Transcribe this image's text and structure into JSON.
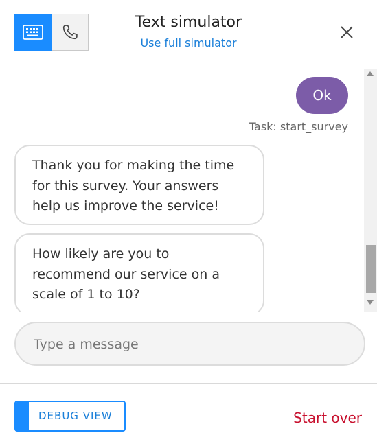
{
  "header": {
    "title": "Text simulator",
    "subtitle_link": "Use full simulator",
    "modes": [
      {
        "name": "keyboard",
        "icon": "keyboard-icon",
        "active": true
      },
      {
        "name": "phone",
        "icon": "phone-icon",
        "active": false
      }
    ],
    "close_icon": "close-icon"
  },
  "chat": {
    "messages": [
      {
        "from": "user",
        "text": "Ok"
      },
      {
        "from": "bot",
        "text": "Thank you for making the time for this survey. Your answers help us improve the service!"
      },
      {
        "from": "bot",
        "text": "How likely are you to recommend our service on a scale of 1 to 10?"
      }
    ],
    "task_label": "Task: start_survey"
  },
  "composer": {
    "placeholder": "Type a message",
    "value": ""
  },
  "footer": {
    "debug_label": "DEBUG VIEW",
    "start_over": "Start over"
  },
  "colors": {
    "accent": "#1a8cff",
    "user_bubble": "#7c5ca8",
    "danger": "#c8102e",
    "link": "#1a7fd9"
  }
}
